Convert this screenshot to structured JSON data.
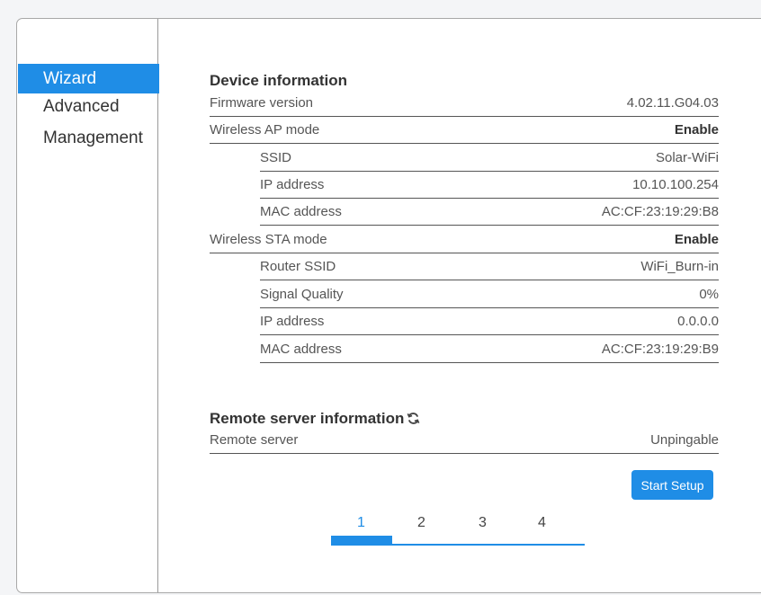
{
  "sidebar": {
    "items": [
      {
        "label": "Wizard",
        "active": true
      },
      {
        "label": "Advanced",
        "active": false
      },
      {
        "label": "Management",
        "active": false
      }
    ]
  },
  "device": {
    "title": "Device information",
    "rows": [
      {
        "label": "Firmware version",
        "value": "4.02.11.G04.03"
      },
      {
        "label": "Wireless AP mode",
        "value": "Enable"
      },
      {
        "label": "SSID",
        "value": "Solar-WiFi"
      },
      {
        "label": "IP address",
        "value": "10.10.100.254"
      },
      {
        "label": "MAC address",
        "value": "AC:CF:23:19:29:B8"
      },
      {
        "label": "Wireless STA mode",
        "value": "Enable"
      },
      {
        "label": "Router SSID",
        "value": "WiFi_Burn-in"
      },
      {
        "label": "Signal Quality",
        "value": "0%"
      },
      {
        "label": "IP address",
        "value": "0.0.0.0"
      },
      {
        "label": "MAC address",
        "value": "AC:CF:23:19:29:B9"
      }
    ]
  },
  "remote": {
    "title": "Remote server information",
    "icon": "refresh-icon",
    "rows": [
      {
        "label": "Remote server",
        "value": "Unpingable"
      }
    ]
  },
  "actions": {
    "start_setup": "Start Setup"
  },
  "steps": {
    "labels": [
      "1",
      "2",
      "3",
      "4"
    ],
    "current": 1
  },
  "colors": {
    "accent": "#1f8de6"
  }
}
